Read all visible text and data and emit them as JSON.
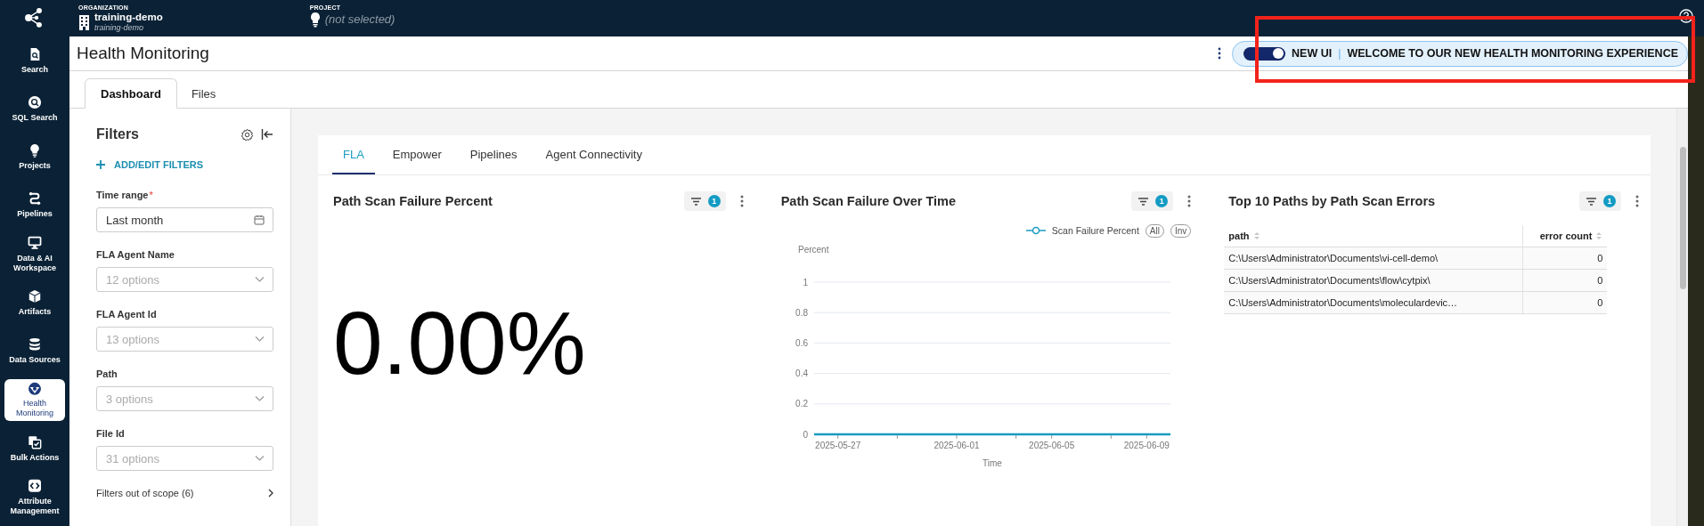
{
  "header": {
    "organization_label": "ORGANIZATION",
    "organization_name": "training-demo",
    "organization_subtitle": "training-demo",
    "project_label": "PROJECT",
    "project_value": "(not selected)"
  },
  "sidebar": {
    "items": [
      {
        "kind": "search",
        "label": "Search",
        "selected": false
      },
      {
        "kind": "sql",
        "label": "SQL Search",
        "selected": false
      },
      {
        "kind": "projects",
        "label": "Projects",
        "selected": false
      },
      {
        "kind": "pipelines",
        "label": "Pipelines",
        "selected": false
      },
      {
        "kind": "workspace",
        "label": "Data & AI Workspace",
        "selected": false
      },
      {
        "kind": "artifacts",
        "label": "Artifacts",
        "selected": false
      },
      {
        "kind": "datasources",
        "label": "Data Sources",
        "selected": false
      },
      {
        "kind": "health",
        "label": "Health Monitoring",
        "selected": true
      },
      {
        "kind": "bulk",
        "label": "Bulk Actions",
        "selected": false
      },
      {
        "kind": "attributes",
        "label": "Attribute Management",
        "selected": false
      }
    ]
  },
  "page": {
    "title": "Health Monitoring",
    "banner": {
      "toggle_on": true,
      "label": "NEW UI",
      "separator": "|",
      "message": "WELCOME TO OUR NEW HEALTH MONITORING EXPERIENCE"
    }
  },
  "tabs": [
    {
      "label": "Dashboard",
      "selected": true
    },
    {
      "label": "Files",
      "selected": false
    }
  ],
  "filters": {
    "title": "Filters",
    "add_label": "ADD/EDIT FILTERS",
    "fields": [
      {
        "kind": "date",
        "label": "Time range",
        "required_mark": "*",
        "value": "Last month"
      },
      {
        "kind": "select",
        "label": "FLA Agent Name",
        "placeholder": "12 options"
      },
      {
        "kind": "select",
        "label": "FLA Agent Id",
        "placeholder": "13 options"
      },
      {
        "kind": "select",
        "label": "Path",
        "placeholder": "3 options"
      },
      {
        "kind": "select",
        "label": "File Id",
        "placeholder": "31 options"
      }
    ],
    "out_of_scope": "Filters out of scope (6)"
  },
  "dashboard": {
    "tabs": [
      {
        "label": "FLA",
        "selected": true
      },
      {
        "label": "Empower",
        "selected": false
      },
      {
        "label": "Pipelines",
        "selected": false
      },
      {
        "label": "Agent Connectivity",
        "selected": false
      }
    ],
    "widgets": [
      {
        "kind": "metric",
        "title": "Path Scan Failure Percent",
        "filter_count": "1",
        "value": "0.00%"
      },
      {
        "kind": "line",
        "title": "Path Scan Failure Over Time",
        "filter_count": "1",
        "legend_buttons": [
          "All",
          "Inv"
        ],
        "chart_data": {
          "type": "line",
          "xlabel": "Time",
          "ylabel": "Percent",
          "categories": [
            null,
            "2025-05-27",
            null,
            null,
            null,
            null,
            "2025-06-01",
            null,
            null,
            null,
            "2025-06-05",
            null,
            null,
            null,
            "2025-06-09",
            null
          ],
          "grid": true,
          "series": [
            {
              "name": "Scan Failure Percent",
              "color": "#1a9bbf",
              "values": [
                0,
                0,
                0,
                0,
                0,
                0,
                0,
                0,
                0,
                0,
                0,
                0,
                0,
                0,
                0,
                0
              ]
            }
          ],
          "ylim": [
            0,
            1
          ],
          "yticks": [
            0,
            0.2,
            0.4,
            0.6,
            0.8,
            1
          ]
        }
      },
      {
        "kind": "table",
        "title": "Top 10 Paths by Path Scan Errors",
        "filter_count": "1",
        "columns": [
          "path",
          "error count"
        ],
        "rows": [
          [
            "C:\\Users\\Administrator\\Documents\\vi-cell-demo\\",
            "0"
          ],
          [
            "C:\\Users\\Administrator\\Documents\\flow\\cytpix\\",
            "0"
          ],
          [
            "C:\\Users\\Administrator\\Documents\\moleculardevic…",
            "0"
          ]
        ]
      }
    ]
  }
}
